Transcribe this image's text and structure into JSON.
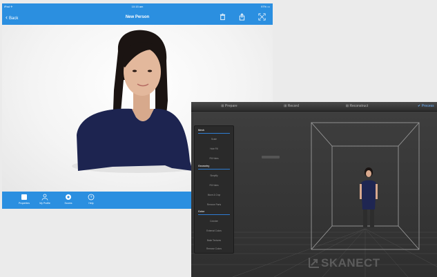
{
  "ipad": {
    "status": {
      "left": "iPad ✈",
      "time": "10:15 am",
      "right": "97% ▭"
    },
    "nav": {
      "back_label": "Back",
      "title": "New Person"
    },
    "tabs": [
      {
        "label": "Properties",
        "icon": "square-icon"
      },
      {
        "label": "My Profile",
        "icon": "person-icon"
      },
      {
        "label": "Scores",
        "icon": "gear-icon"
      },
      {
        "label": "Help",
        "icon": "help-icon"
      }
    ]
  },
  "skanect": {
    "tabs": [
      "Prepare",
      "Record",
      "Reconstruct",
      "Process"
    ],
    "active_tab": "Process",
    "panel": {
      "mesh_header": "Mesh",
      "mesh_items": [
        "Scale",
        "Hole Fill",
        "Fill Holes"
      ],
      "geometry_header": "Geometry",
      "geometry_items": [
        "Simplify",
        "Fill Holes",
        "Move & Crop",
        "Remove Parts"
      ],
      "color_header": "Color",
      "color_items": [
        "Colorize",
        "External Colors",
        "Bake Textures",
        "Remove Colors"
      ]
    },
    "logo_text": "SKANECT"
  },
  "colors": {
    "ipad_blue": "#2b8fe0",
    "skanect_bg": "#3a3a3a",
    "skanect_accent": "#6fb4ff"
  }
}
